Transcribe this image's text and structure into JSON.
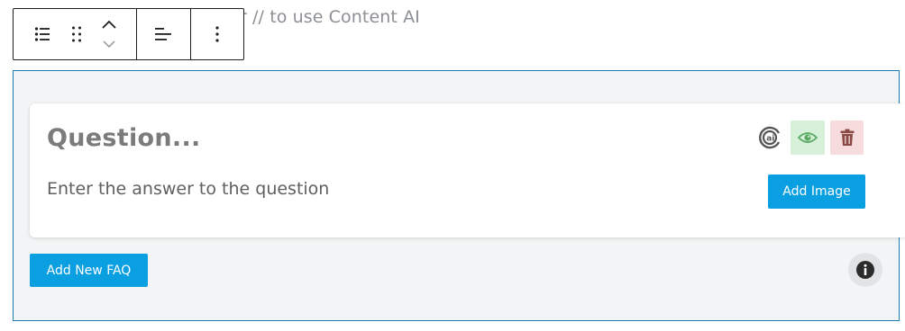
{
  "editor": {
    "placeholder_fragment": "r // to use Content AI"
  },
  "toolbar": {
    "icons": [
      "list-icon",
      "drag-handle-icon",
      "chevron-up-icon",
      "chevron-down-icon",
      "align-left-icon",
      "more-options-icon"
    ]
  },
  "faq": {
    "question_placeholder": "Question...",
    "answer_placeholder": "Enter the answer to the question",
    "add_image_label": "Add Image",
    "add_new_label": "Add New FAQ",
    "icons": [
      "content-ai-icon",
      "eye-icon",
      "trash-icon",
      "info-icon"
    ]
  },
  "colors": {
    "accent": "#0a9fe0",
    "block_border": "#1a7fb0",
    "block_bg": "#f2f4f5",
    "eye_bg": "#d7f0d9",
    "eye_icon": "#5aaa64",
    "trash_bg": "#f6dcdc",
    "trash_icon": "#8a4a44"
  }
}
